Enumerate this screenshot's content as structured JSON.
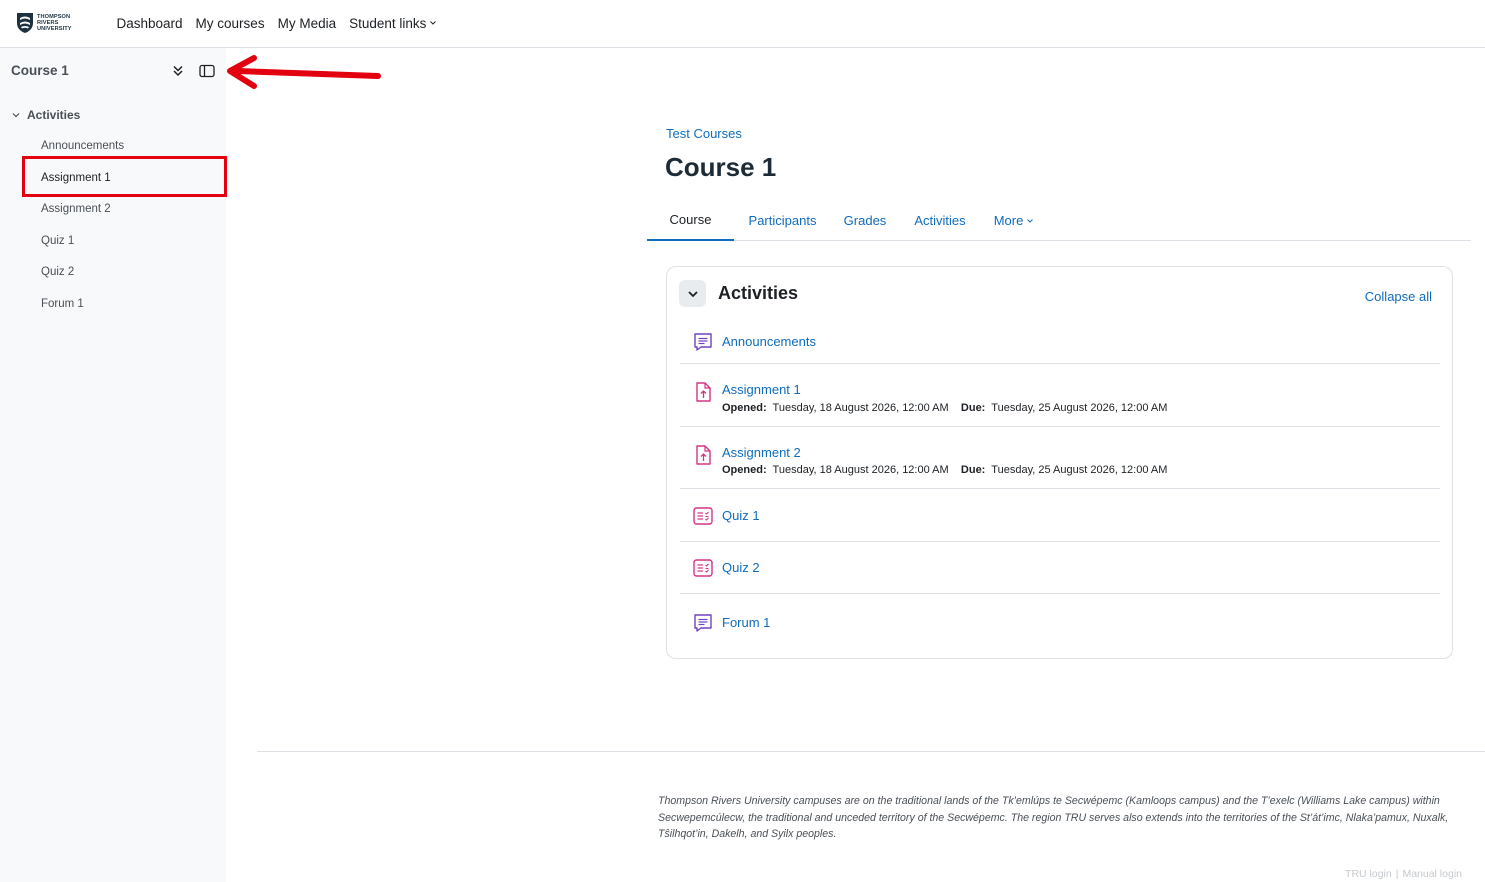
{
  "navbar": {
    "logo_lines": [
      "THOMPSON",
      "RIVERS",
      "UNIVERSITY"
    ],
    "links": [
      {
        "label": "Dashboard"
      },
      {
        "label": "My courses"
      },
      {
        "label": "My Media"
      },
      {
        "label": "Student links"
      }
    ]
  },
  "drawer": {
    "title": "Course 1",
    "section": "Activities",
    "items": [
      {
        "label": "Announcements"
      },
      {
        "label": "Assignment 1"
      },
      {
        "label": "Assignment 2"
      },
      {
        "label": "Quiz 1"
      },
      {
        "label": "Quiz 2"
      },
      {
        "label": "Forum 1"
      }
    ]
  },
  "main": {
    "breadcrumb": "Test Courses",
    "title": "Course 1",
    "tabs": [
      {
        "label": "Course"
      },
      {
        "label": "Participants"
      },
      {
        "label": "Grades"
      },
      {
        "label": "Activities"
      },
      {
        "label": "More"
      }
    ],
    "section": {
      "title": "Activities",
      "collapse_all": "Collapse all",
      "activities": [
        {
          "name": "Announcements",
          "icon": "forum-icon"
        },
        {
          "name": "Assignment 1",
          "icon": "assignment-icon",
          "opened_label": "Opened:",
          "opened": "Tuesday, 18 August 2026, 12:00 AM",
          "due_label": "Due:",
          "due": "Tuesday, 25 August 2026, 12:00 AM"
        },
        {
          "name": "Assignment 2",
          "icon": "assignment-icon",
          "opened_label": "Opened:",
          "opened": "Tuesday, 18 August 2026, 12:00 AM",
          "due_label": "Due:",
          "due": "Tuesday, 25 August 2026, 12:00 AM"
        },
        {
          "name": "Quiz 1",
          "icon": "quiz-icon"
        },
        {
          "name": "Quiz 2",
          "icon": "quiz-icon"
        },
        {
          "name": "Forum 1",
          "icon": "forum-icon"
        }
      ]
    }
  },
  "footer": {
    "land_acknowledgement": "Thompson Rivers University campuses are on the traditional lands of the Tk’emlúps te Secwépemc (Kamloops campus) and the T’exelc (Williams Lake campus) within Secwepemcúlecw, the traditional and unceded territory of the Secwépemc. The region TRU serves also extends into the territories of the St’át’imc, Nlaka’pamux, Nuxalk, Tŝilhqot’in, Dakelh, and Syilx peoples.",
    "tru_login": "TRU login",
    "separator": "|",
    "manual_login": "Manual login"
  },
  "colors": {
    "link": "#0f6cbf",
    "assignment_icon": "#d63384",
    "forum_icon": "#6f42c1",
    "annotation": "#e3000f"
  }
}
